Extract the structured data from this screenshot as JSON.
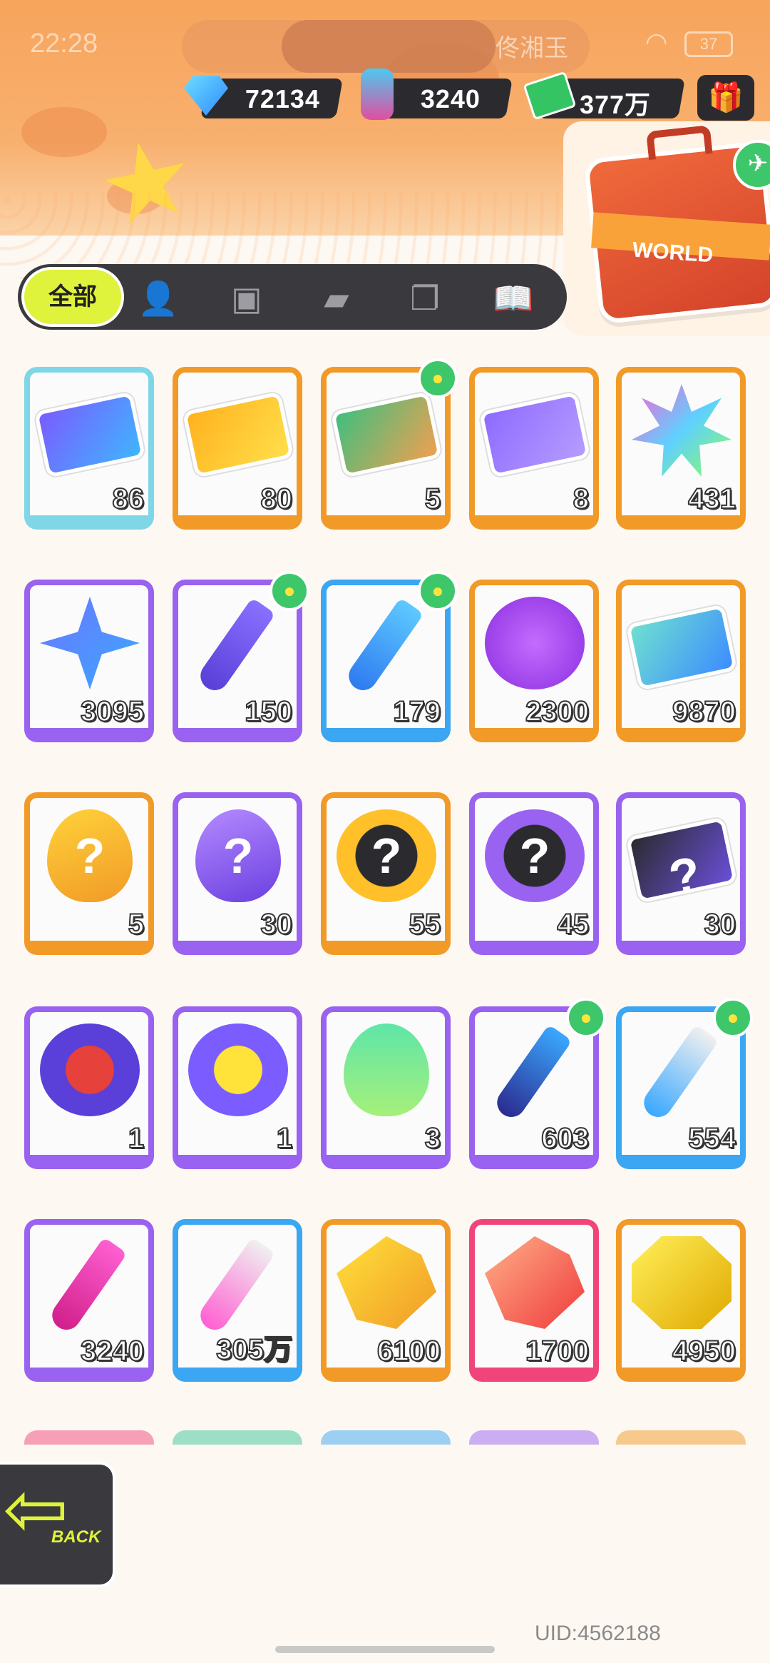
{
  "statusbar": {
    "time": "22:28",
    "carrier": "佟湘玉",
    "battery": "37"
  },
  "currency": [
    {
      "name": "gem",
      "value": "72134"
    },
    {
      "name": "spray",
      "value": "3240"
    },
    {
      "name": "cash",
      "value": "377万"
    }
  ],
  "world_card": {
    "label": "WORLD"
  },
  "tabs": {
    "all_label": "全部"
  },
  "colors": {
    "orange": "#f19a27",
    "purple": "#9a62f0",
    "blue": "#3ba6f2",
    "pink": "#f0457a",
    "accent": "#dff23c"
  },
  "items": [
    {
      "qty": "86",
      "icon": "purple-deity-ticket-icon",
      "rarity": "rainbow"
    },
    {
      "qty": "80",
      "icon": "gold-deity-ticket-icon",
      "rarity": "orange"
    },
    {
      "qty": "5",
      "icon": "green-deity-ticket-icon",
      "rarity": "orange",
      "badge": true
    },
    {
      "qty": "8",
      "icon": "violet-deity-ticket-icon",
      "rarity": "orange"
    },
    {
      "qty": "431",
      "icon": "rainbow-star-icon",
      "rarity": "orange"
    },
    {
      "qty": "3095",
      "icon": "blue-star-icon",
      "rarity": "purple"
    },
    {
      "qty": "150",
      "icon": "purple-crayon-icon",
      "rarity": "purple",
      "badge": true
    },
    {
      "qty": "179",
      "icon": "blue-crayon-icon",
      "rarity": "blue",
      "badge": true
    },
    {
      "qty": "2300",
      "icon": "cool-paint-icon",
      "rarity": "orange"
    },
    {
      "qty": "9870",
      "icon": "season-ticket-icon",
      "rarity": "orange"
    },
    {
      "qty": "5",
      "icon": "gold-mystery-egg-icon",
      "rarity": "orange"
    },
    {
      "qty": "30",
      "icon": "purple-mystery-egg-icon",
      "rarity": "purple"
    },
    {
      "qty": "55",
      "icon": "gold-deity-mystery-icon",
      "rarity": "orange"
    },
    {
      "qty": "45",
      "icon": "purple-deity-mystery-icon",
      "rarity": "purple"
    },
    {
      "qty": "30",
      "icon": "travel-card-mystery-icon",
      "rarity": "purple"
    },
    {
      "qty": "1",
      "icon": "fish-medal-icon",
      "rarity": "purple"
    },
    {
      "qty": "1",
      "icon": "octopus-medal-icon",
      "rarity": "purple"
    },
    {
      "qty": "3",
      "icon": "green-cup-icon",
      "rarity": "purple"
    },
    {
      "qty": "603",
      "icon": "blue-spray-can-icon",
      "rarity": "purple",
      "badge": true
    },
    {
      "qty": "554",
      "icon": "blue-paint-tube-icon",
      "rarity": "blue",
      "badge": true
    },
    {
      "qty": "3240",
      "icon": "pink-spray-can-icon",
      "rarity": "purple"
    },
    {
      "qty": "305万",
      "icon": "rainbow-paint-tube-icon",
      "rarity": "blue"
    },
    {
      "qty": "6100",
      "icon": "gold-crystal-icon",
      "rarity": "orange"
    },
    {
      "qty": "1700",
      "icon": "red-crystal-icon",
      "rarity": "pink"
    },
    {
      "qty": "4950",
      "icon": "yellow-gem-icon",
      "rarity": "orange"
    }
  ],
  "back_button": {
    "label": "BACK"
  },
  "uid": "UID:4562188"
}
